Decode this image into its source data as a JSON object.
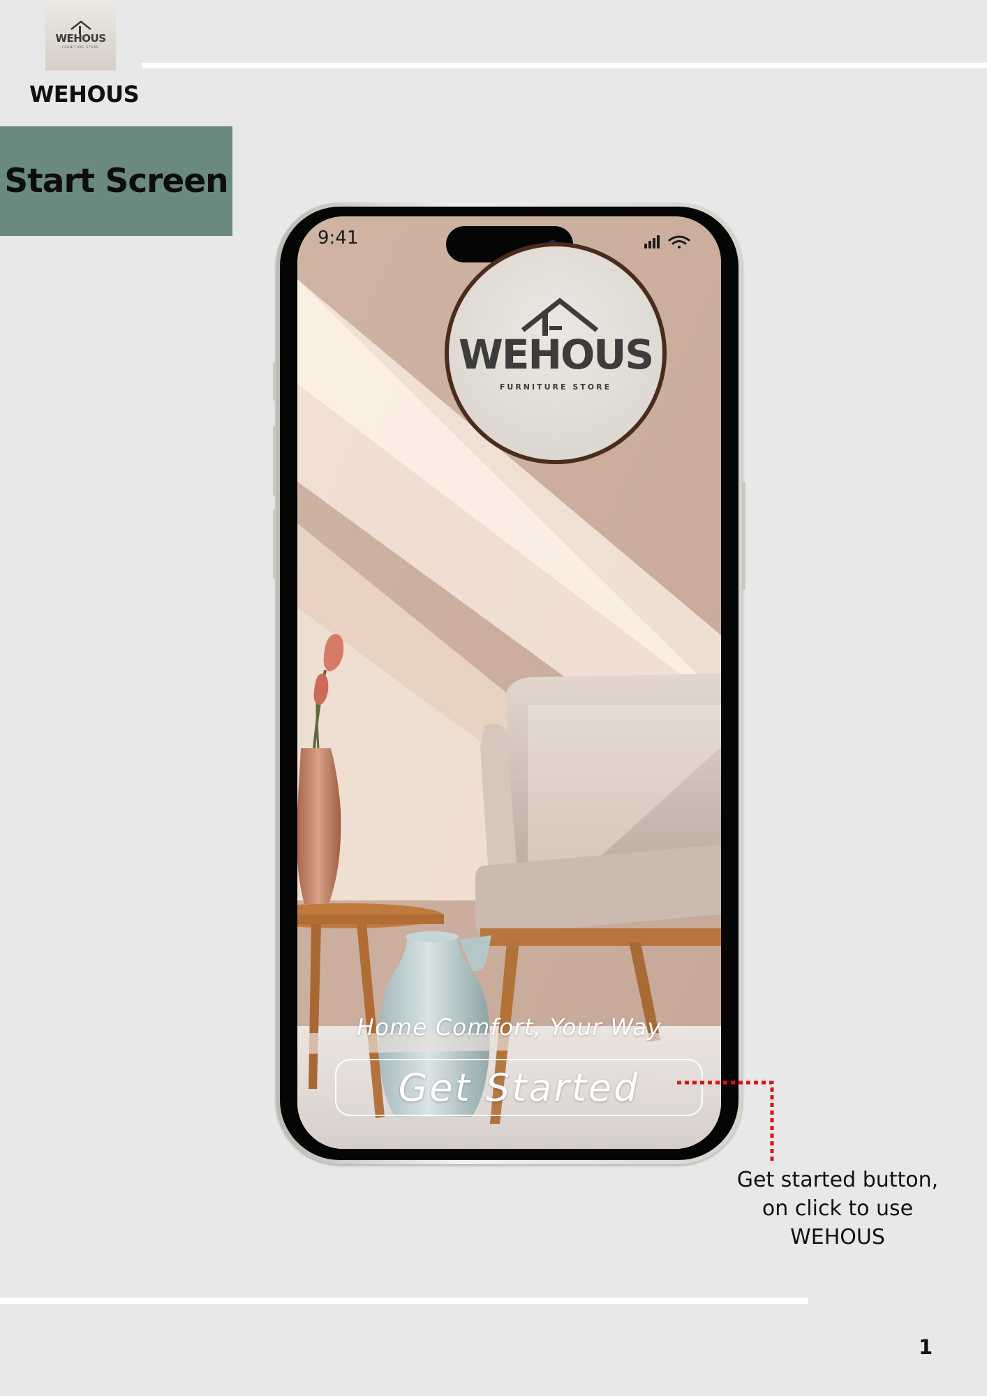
{
  "header": {
    "logo_wordmark": "WEHOUS",
    "logo_tagline": "FURNITURE STORE",
    "brand_name": "WEHOUS"
  },
  "section": {
    "label": "Start Screen"
  },
  "phone": {
    "status_bar": {
      "time": "9:41",
      "icons": [
        "signal-icon",
        "wifi-icon"
      ]
    },
    "app": {
      "logo_wordmark": "WEHOUS",
      "logo_tagline": "FURNITURE STORE",
      "tagline": "Home Comfort, Your Way",
      "get_started_label": "Get Started"
    }
  },
  "annotation": {
    "text": "Get started button, on click to use WEHOUS"
  },
  "page_number": "1",
  "colors": {
    "page_background": "#e8e8e8",
    "section_label_background": "#6a8980",
    "logo_ring": "#4a2c1c",
    "connector": "#e0101a"
  }
}
